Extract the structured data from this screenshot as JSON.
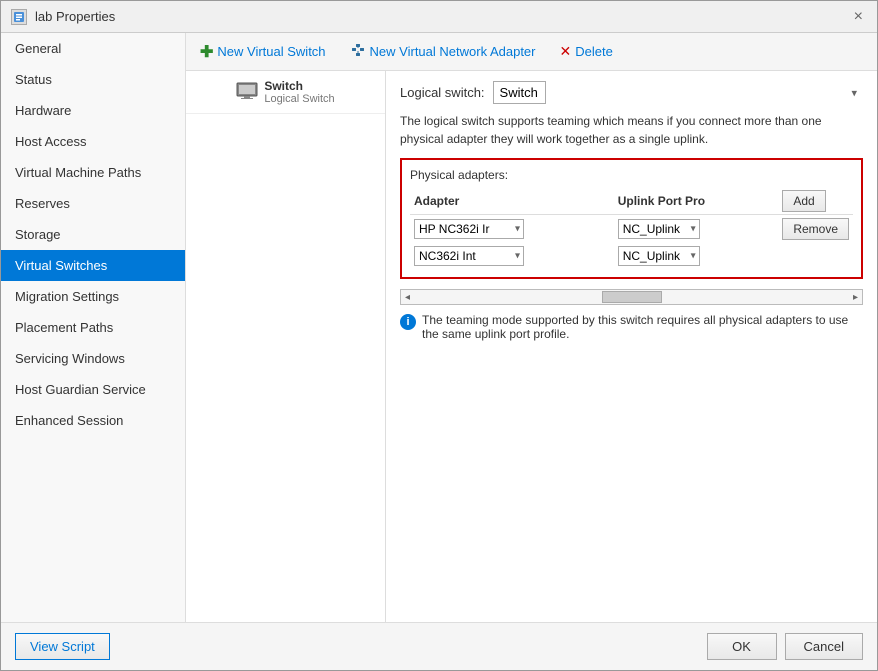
{
  "window": {
    "title": "lab Properties",
    "close_label": "×"
  },
  "toolbar": {
    "new_virtual_switch": "New Virtual Switch",
    "new_virtual_network_adapter": "New Virtual Network Adapter",
    "delete": "Delete"
  },
  "sidebar": {
    "items": [
      {
        "id": "general",
        "label": "General",
        "active": false
      },
      {
        "id": "status",
        "label": "Status",
        "active": false
      },
      {
        "id": "hardware",
        "label": "Hardware",
        "active": false
      },
      {
        "id": "host-access",
        "label": "Host Access",
        "active": false
      },
      {
        "id": "virtual-machine-paths",
        "label": "Virtual Machine Paths",
        "active": false
      },
      {
        "id": "reserves",
        "label": "Reserves",
        "active": false
      },
      {
        "id": "storage",
        "label": "Storage",
        "active": false
      },
      {
        "id": "virtual-switches",
        "label": "Virtual Switches",
        "active": true
      },
      {
        "id": "migration-settings",
        "label": "Migration Settings",
        "active": false
      },
      {
        "id": "placement-paths",
        "label": "Placement Paths",
        "active": false
      },
      {
        "id": "servicing-windows",
        "label": "Servicing Windows",
        "active": false
      },
      {
        "id": "host-guardian-service",
        "label": "Host Guardian Service",
        "active": false
      },
      {
        "id": "enhanced-session",
        "label": "Enhanced Session",
        "active": false
      }
    ]
  },
  "switch_list": {
    "item": {
      "icon": "🖥",
      "name": "Switch",
      "sub": "Logical Switch"
    }
  },
  "detail": {
    "logical_switch_label": "Logical switch:",
    "logical_switch_value": "Switch",
    "description": "The logical switch supports teaming which means if you connect more than one physical adapter they will work together as a single uplink.",
    "physical_adapters_title": "Physical adapters:",
    "col_adapter": "Adapter",
    "col_uplink": "Uplink Port Pro",
    "add_btn": "Add",
    "remove_btn": "Remove",
    "adapters": [
      {
        "name": "HP NC362i Ir",
        "uplink": "NC_Uplink"
      },
      {
        "name": "NC362i Int",
        "uplink": "NC_Uplink"
      }
    ],
    "info_text": "The teaming mode supported by this switch requires all physical adapters to use the same uplink port profile."
  },
  "footer": {
    "view_script": "View Script",
    "ok": "OK",
    "cancel": "Cancel"
  }
}
